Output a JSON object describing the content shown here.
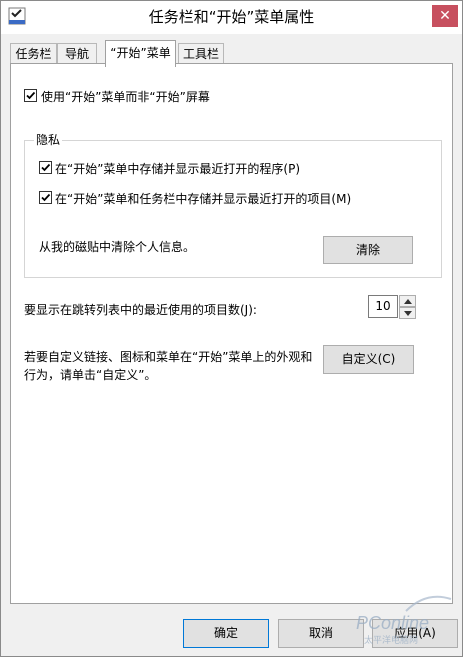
{
  "window": {
    "title": "任务栏和“开始”菜单属性",
    "close_glyph": "✕"
  },
  "tabs": [
    {
      "label": "任务栏",
      "active": false
    },
    {
      "label": "导航",
      "active": false
    },
    {
      "label": "“开始”菜单",
      "active": true
    },
    {
      "label": "工具栏",
      "active": false
    }
  ],
  "start_menu": {
    "use_start_menu_label": "使用“开始”菜单而非“开始”屏幕",
    "use_start_menu_checked": true
  },
  "privacy": {
    "group_title": "隐私",
    "store_programs_label": "在“开始”菜单中存储并显示最近打开的程序(P)",
    "store_programs_checked": true,
    "store_items_label": "在“开始”菜单和任务栏中存储并显示最近打开的项目(M)",
    "store_items_checked": true,
    "clear_tiles_text": "从我的磁贴中清除个人信息。",
    "clear_button": "清除"
  },
  "jump_list": {
    "label": "要显示在跳转列表中的最近使用的项目数(J):",
    "value": "10"
  },
  "customize": {
    "text_line1": "若要自定义链接、图标和菜单在“开始”菜单上的外观和",
    "text_line2": "行为，请单击“自定义”。",
    "button": "自定义(C)"
  },
  "footer": {
    "ok": "确定",
    "cancel": "取消",
    "apply": "应用(A)"
  },
  "watermark": {
    "brand": "PConline",
    "tagline": "太平洋电脑网"
  }
}
